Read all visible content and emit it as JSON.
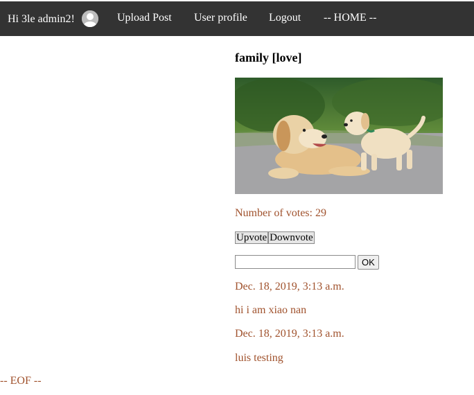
{
  "nav": {
    "greeting": "Hi 3le admin2!",
    "avatar_icon": "user-avatar-icon",
    "upload": "Upload Post",
    "profile": "User profile",
    "logout": "Logout",
    "home": "-- HOME --",
    "background": "#333333"
  },
  "post": {
    "title": "family [love]",
    "image_icon": "dog-and-puppy-photo",
    "votes_text": "Number of votes: 29",
    "upvote": "Upvote",
    "downvote": "Downvote",
    "comment_value": "",
    "ok": "OK"
  },
  "comments": [
    {
      "date": "Dec. 18, 2019, 3:13 a.m.",
      "text": "hi i am xiao nan"
    },
    {
      "date": "Dec. 18, 2019, 3:13 a.m.",
      "text": "luis testing"
    }
  ],
  "footer": {
    "eof": "-- EOF --"
  },
  "colors": {
    "accent_text": "#a0522d"
  }
}
